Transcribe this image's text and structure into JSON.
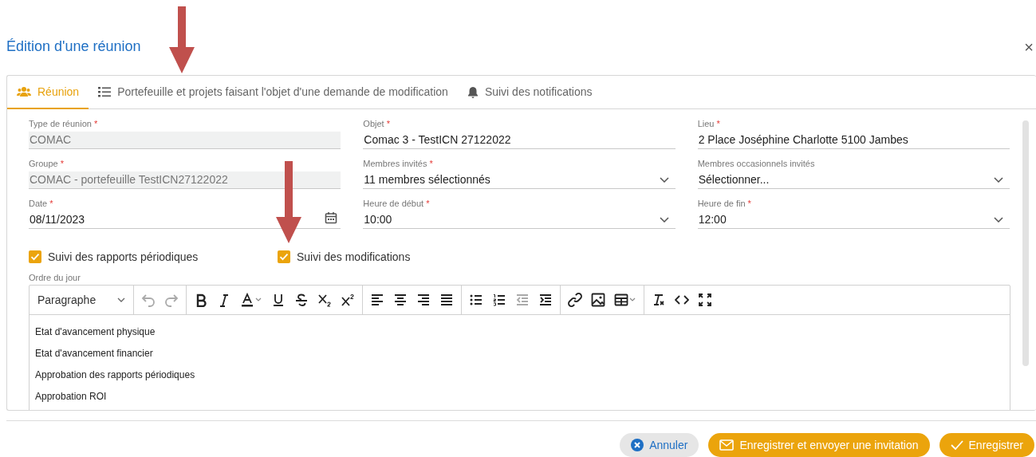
{
  "dialog": {
    "title": "Édition d'une réunion",
    "close": "×"
  },
  "tabs": [
    {
      "label": "Réunion",
      "selected": true
    },
    {
      "label": "Portefeuille et projets faisant l'objet d'une demande de modification",
      "selected": false
    },
    {
      "label": "Suivi des notifications",
      "selected": false
    }
  ],
  "fields": [
    {
      "label": "Type de réunion",
      "required_mark": "*",
      "value": "COMAC",
      "kind": "readonly"
    },
    {
      "label": "Objet",
      "required_mark": "*",
      "value": "Comac 3 - TestICN 27122022",
      "kind": "text"
    },
    {
      "label": "Lieu",
      "required_mark": "*",
      "value": "2 Place Joséphine Charlotte  5100 Jambes",
      "kind": "text"
    },
    {
      "label": "Groupe",
      "required_mark": "*",
      "value": "COMAC - portefeuille TestICN27122022",
      "kind": "readonly"
    },
    {
      "label": "Membres invités",
      "required_mark": "*",
      "value": "11 membres sélectionnés",
      "kind": "select"
    },
    {
      "label": "Membres occasionnels invités",
      "value": "Sélectionner...",
      "kind": "select"
    },
    {
      "label": "Date",
      "required_mark": "*",
      "value": "08/11/2023",
      "kind": "date"
    },
    {
      "label": "Heure de début",
      "required_mark": "*",
      "value": "10:00",
      "kind": "select"
    },
    {
      "label": "Heure de fin",
      "required_mark": "*",
      "value": "12:00",
      "kind": "select"
    }
  ],
  "checkboxes": [
    {
      "label": "Suivi des rapports périodiques",
      "checked": true
    },
    {
      "label": "Suivi des modifications",
      "checked": true
    }
  ],
  "agenda": {
    "label": "Ordre du jour",
    "block_format": "Paragraphe",
    "toolbar": [
      [
        {
          "kind": "undo",
          "disabled": true
        },
        {
          "kind": "redo",
          "disabled": true
        }
      ],
      [
        {
          "kind": "bold",
          "disabled": false
        },
        {
          "kind": "italic",
          "disabled": false
        },
        {
          "kind": "color",
          "disabled": false
        },
        {
          "kind": "underline",
          "disabled": false
        },
        {
          "kind": "strike",
          "disabled": false
        },
        {
          "kind": "sub",
          "disabled": false
        },
        {
          "kind": "sup",
          "disabled": false
        }
      ],
      [
        {
          "kind": "left",
          "disabled": false
        },
        {
          "kind": "center",
          "disabled": false
        },
        {
          "kind": "right",
          "disabled": false
        },
        {
          "kind": "justify",
          "disabled": false
        }
      ],
      [
        {
          "kind": "bullets",
          "disabled": false
        },
        {
          "kind": "numbers",
          "disabled": false
        },
        {
          "kind": "outdent",
          "disabled": true
        },
        {
          "kind": "indent",
          "disabled": false
        }
      ],
      [
        {
          "kind": "link",
          "disabled": false
        },
        {
          "kind": "image",
          "disabled": false
        },
        {
          "kind": "table",
          "disabled": false
        }
      ],
      [
        {
          "kind": "clear",
          "disabled": false
        },
        {
          "kind": "code",
          "disabled": false
        },
        {
          "kind": "fullscreen",
          "disabled": false
        }
      ]
    ],
    "lines": [
      "Etat d'avancement physique",
      "Etat d'avancement financier",
      "Approbation des rapports périodiques",
      "Approbation ROI"
    ]
  },
  "buttons": [
    {
      "label": "Annuler",
      "kind": "cancel"
    },
    {
      "label": "Enregistrer et envoyer une invitation",
      "kind": "send"
    },
    {
      "label": "Enregistrer",
      "kind": "save"
    }
  ],
  "annotations": [
    {
      "kind": "arrow"
    },
    {
      "kind": "arrow"
    }
  ]
}
